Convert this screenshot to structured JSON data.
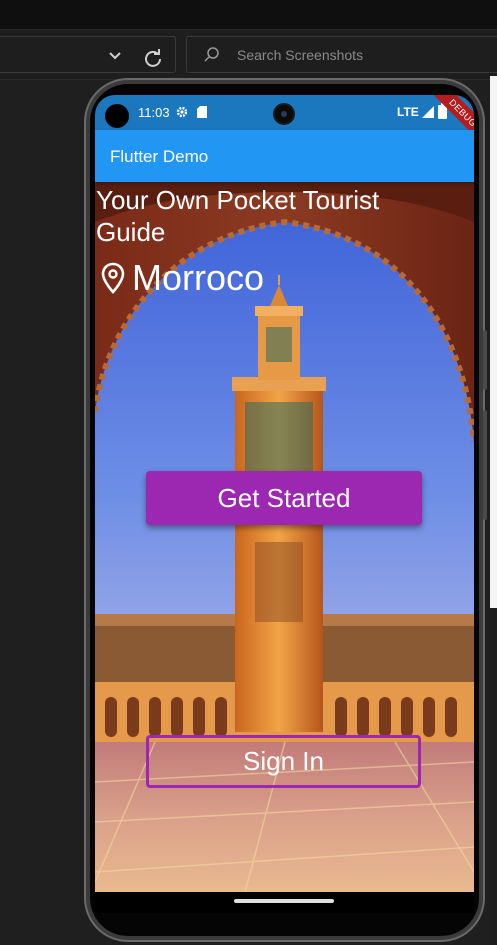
{
  "ide": {
    "search_placeholder": "Search Screenshots"
  },
  "device": {
    "status_time": "11:03",
    "network": "LTE",
    "debug_banner": "DEBUG"
  },
  "app": {
    "title": "Flutter Demo",
    "headline": "Your Own Pocket Tourist Guide",
    "location": "Morroco",
    "primary_button": "Get Started",
    "secondary_button": "Sign In",
    "accent_color": "#9c27b0",
    "appbar_color": "#2196f3"
  },
  "icons": {
    "location": "location-pin-icon",
    "settings": "gear-icon",
    "search": "search-icon",
    "refresh": "refresh-icon"
  }
}
